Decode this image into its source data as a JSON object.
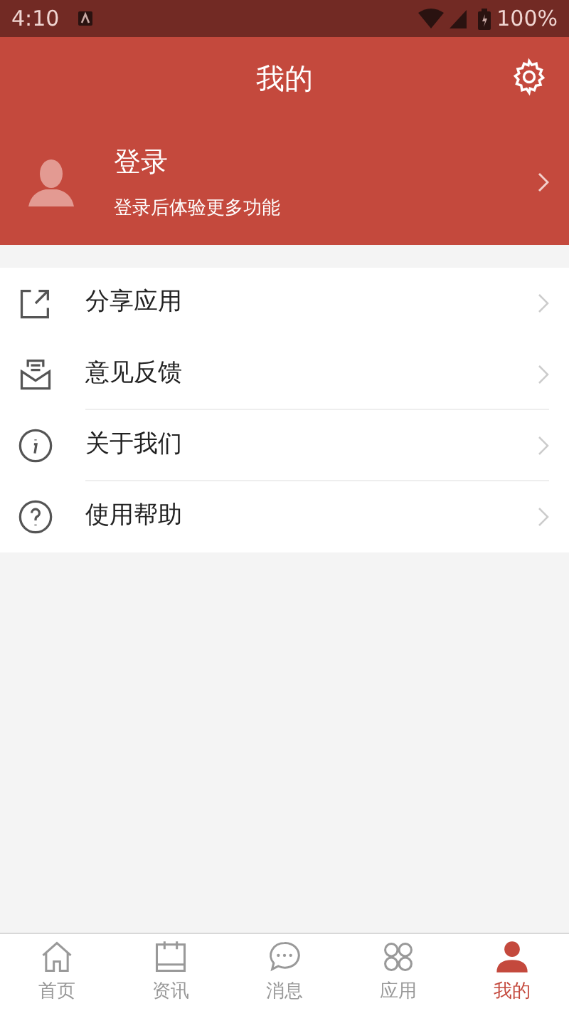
{
  "status_bar": {
    "time": "4:10",
    "battery": "100%"
  },
  "header": {
    "title": "我的"
  },
  "profile": {
    "name": "登录",
    "subtitle": "登录后体验更多功能"
  },
  "menu": [
    {
      "kind": "share",
      "label": "分享应用"
    },
    {
      "kind": "feedback",
      "label": "意见反馈"
    },
    {
      "kind": "about",
      "label": "关于我们"
    },
    {
      "kind": "help",
      "label": "使用帮助"
    }
  ],
  "tabs": [
    {
      "kind": "home",
      "label": "首页",
      "selected": false
    },
    {
      "kind": "calendar",
      "label": "资讯",
      "selected": false
    },
    {
      "kind": "chat",
      "label": "消息",
      "selected": false
    },
    {
      "kind": "grid",
      "label": "应用",
      "selected": false
    },
    {
      "kind": "person",
      "label": "我的",
      "selected": true
    }
  ]
}
